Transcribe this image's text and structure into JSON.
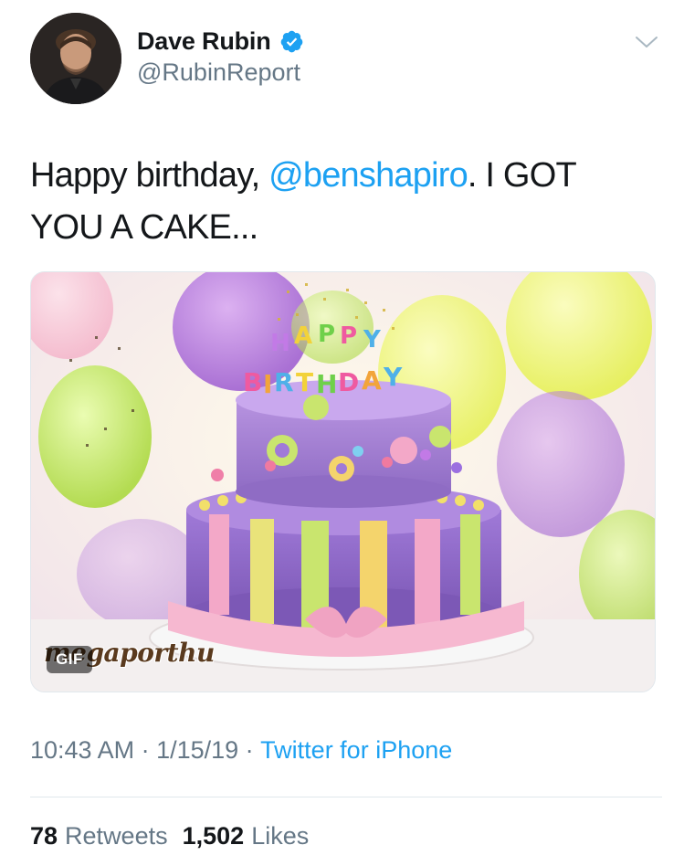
{
  "author": {
    "display_name": "Dave Rubin",
    "handle": "@RubinReport",
    "verified": true,
    "avatar_icon": "profile-photo"
  },
  "tweet": {
    "text_before": "Happy birthday, ",
    "mention": "@benshapiro",
    "text_after": ". I GOT YOU A CAKE..."
  },
  "media": {
    "badge": "GIF",
    "watermark": "megaporthu",
    "cake_text": "HAPPY BIRTHDAY"
  },
  "meta": {
    "time": "10:43 AM",
    "separator1": " · ",
    "date": "1/15/19",
    "separator2": " · ",
    "source": "Twitter for iPhone"
  },
  "stats": {
    "retweets_count": "78",
    "retweets_label": "Retweets",
    "likes_count": "1,502",
    "likes_label": "Likes"
  },
  "colors": {
    "link": "#1da1f2",
    "secondary_text": "#657786",
    "primary_text": "#14171a"
  }
}
